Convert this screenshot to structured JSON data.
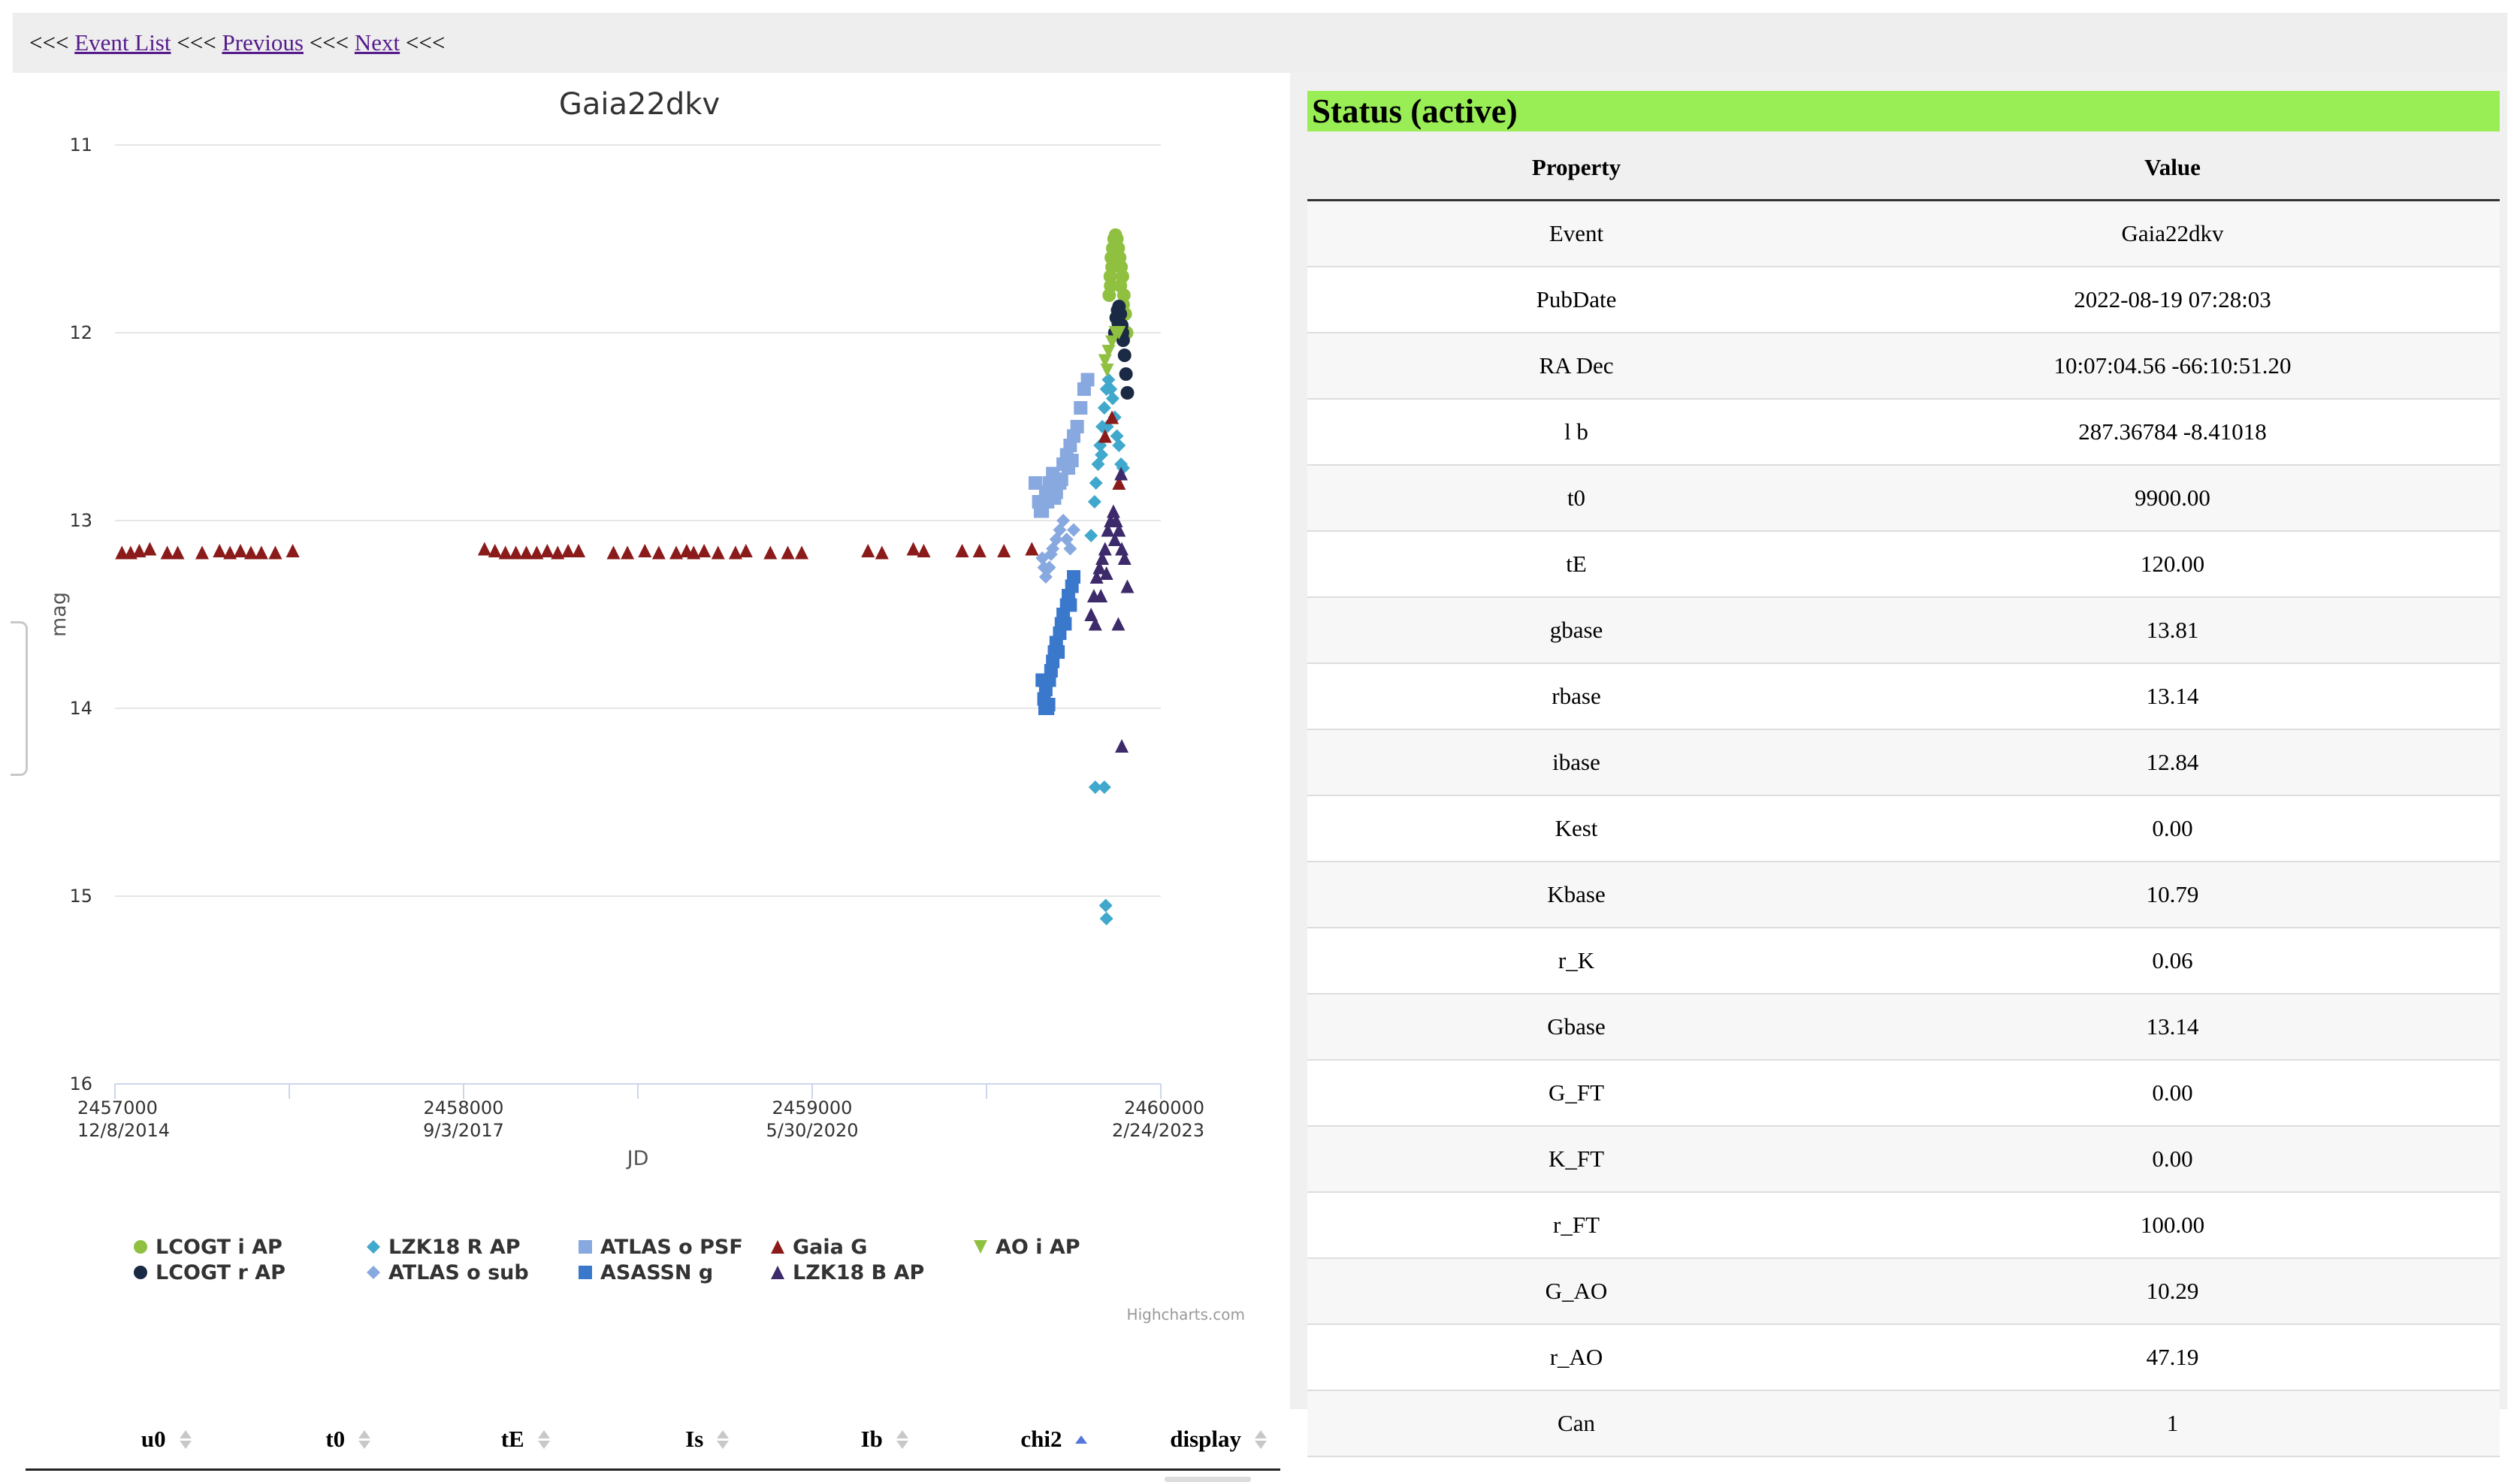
{
  "nav": {
    "sep": "<<<",
    "event_list": "Event List",
    "previous": "Previous",
    "next": "Next"
  },
  "chart_data": {
    "type": "scatter",
    "title": "Gaia22dkv",
    "xlabel": "JD",
    "ylabel": "mag",
    "xlim": [
      2457000,
      2460000
    ],
    "ylim": [
      16,
      11
    ],
    "y_reversed": true,
    "grid": true,
    "legend_position": "bottom",
    "x_ticks": [
      {
        "value": 2457000,
        "label": "2457000",
        "date": "12/8/2014"
      },
      {
        "value": 2458000,
        "label": "2458000",
        "date": "9/3/2017"
      },
      {
        "value": 2459000,
        "label": "2459000",
        "date": "5/30/2020"
      },
      {
        "value": 2460000,
        "label": "2460000",
        "date": "2/24/2023"
      }
    ],
    "y_ticks": [
      11,
      12,
      13,
      14,
      15,
      16
    ],
    "credits": "Highcharts.com",
    "series": [
      {
        "name": "LCOGT i AP",
        "color": "#90c040",
        "marker": "circle",
        "points": [
          [
            2459855,
            11.7
          ],
          [
            2459858,
            11.6
          ],
          [
            2459862,
            11.55
          ],
          [
            2459866,
            11.5
          ],
          [
            2459870,
            11.48
          ],
          [
            2459874,
            11.5
          ],
          [
            2459878,
            11.55
          ],
          [
            2459882,
            11.6
          ],
          [
            2459886,
            11.65
          ],
          [
            2459890,
            11.7
          ],
          [
            2459894,
            11.8
          ],
          [
            2459898,
            11.9
          ],
          [
            2459902,
            12.0
          ],
          [
            2459852,
            11.8
          ],
          [
            2459856,
            11.75
          ],
          [
            2459860,
            11.65
          ],
          [
            2459872,
            11.6
          ],
          [
            2459884,
            11.75
          ],
          [
            2459892,
            11.85
          ]
        ]
      },
      {
        "name": "LCOGT r AP",
        "color": "#1a2a44",
        "marker": "circle",
        "points": [
          [
            2459868,
            12.0
          ],
          [
            2459872,
            11.92
          ],
          [
            2459876,
            11.88
          ],
          [
            2459880,
            11.86
          ],
          [
            2459884,
            11.9
          ],
          [
            2459888,
            11.96
          ],
          [
            2459892,
            12.04
          ],
          [
            2459896,
            12.12
          ],
          [
            2459900,
            12.22
          ],
          [
            2459904,
            12.32
          ],
          [
            2459878,
            11.95
          ],
          [
            2459890,
            12.0
          ]
        ]
      },
      {
        "name": "LZK18 R AP",
        "color": "#40a8cc",
        "marker": "diamond",
        "points": [
          [
            2459820,
            12.7
          ],
          [
            2459826,
            12.6
          ],
          [
            2459832,
            12.5
          ],
          [
            2459838,
            12.4
          ],
          [
            2459844,
            12.3
          ],
          [
            2459850,
            12.25
          ],
          [
            2459856,
            12.3
          ],
          [
            2459862,
            12.35
          ],
          [
            2459868,
            12.45
          ],
          [
            2459874,
            12.55
          ],
          [
            2459880,
            12.6
          ],
          [
            2459886,
            12.7
          ],
          [
            2459892,
            12.72
          ],
          [
            2459810,
            12.9
          ],
          [
            2459814,
            12.8
          ],
          [
            2459830,
            12.65
          ],
          [
            2459846,
            12.5
          ],
          [
            2459800,
            13.08
          ],
          [
            2459812,
            14.42
          ],
          [
            2459838,
            14.42
          ],
          [
            2459842,
            15.05
          ],
          [
            2459844,
            15.12
          ]
        ]
      },
      {
        "name": "ATLAS o sub",
        "color": "#88a8e0",
        "marker": "diamond",
        "points": [
          [
            2459660,
            13.2
          ],
          [
            2459670,
            13.3
          ],
          [
            2459680,
            13.25
          ],
          [
            2459690,
            13.15
          ],
          [
            2459700,
            13.1
          ],
          [
            2459710,
            13.05
          ],
          [
            2459720,
            13.0
          ],
          [
            2459730,
            13.1
          ],
          [
            2459740,
            13.15
          ],
          [
            2459750,
            13.05
          ],
          [
            2459665,
            13.25
          ],
          [
            2459685,
            13.18
          ]
        ]
      },
      {
        "name": "ATLAS o PSF",
        "color": "#88a8e0",
        "marker": "square",
        "points": [
          [
            2459640,
            12.8
          ],
          [
            2459650,
            12.9
          ],
          [
            2459660,
            12.95
          ],
          [
            2459670,
            12.85
          ],
          [
            2459680,
            12.8
          ],
          [
            2459690,
            12.75
          ],
          [
            2459700,
            12.85
          ],
          [
            2459710,
            12.8
          ],
          [
            2459720,
            12.7
          ],
          [
            2459730,
            12.65
          ],
          [
            2459740,
            12.6
          ],
          [
            2459750,
            12.55
          ],
          [
            2459760,
            12.5
          ],
          [
            2459770,
            12.4
          ],
          [
            2459780,
            12.3
          ],
          [
            2459790,
            12.25
          ],
          [
            2459655,
            12.95
          ],
          [
            2459675,
            12.9
          ],
          [
            2459695,
            12.88
          ],
          [
            2459715,
            12.78
          ],
          [
            2459735,
            12.72
          ],
          [
            2459745,
            12.68
          ]
        ]
      },
      {
        "name": "ASASSN g",
        "color": "#3a78cc",
        "marker": "square",
        "points": [
          [
            2459660,
            13.85
          ],
          [
            2459665,
            13.95
          ],
          [
            2459670,
            13.9
          ],
          [
            2459675,
            14.0
          ],
          [
            2459680,
            13.85
          ],
          [
            2459685,
            13.8
          ],
          [
            2459690,
            13.75
          ],
          [
            2459695,
            13.7
          ],
          [
            2459700,
            13.65
          ],
          [
            2459705,
            13.7
          ],
          [
            2459710,
            13.6
          ],
          [
            2459715,
            13.55
          ],
          [
            2459720,
            13.5
          ],
          [
            2459725,
            13.55
          ],
          [
            2459730,
            13.45
          ],
          [
            2459735,
            13.4
          ],
          [
            2459740,
            13.45
          ],
          [
            2459745,
            13.35
          ],
          [
            2459750,
            13.3
          ],
          [
            2459668,
            14.0
          ],
          [
            2459678,
            13.98
          ]
        ]
      },
      {
        "name": "Gaia G",
        "color": "#8b1a1a",
        "marker": "triangle",
        "points": [
          [
            2457020,
            13.17
          ],
          [
            2457045,
            13.17
          ],
          [
            2457070,
            13.16
          ],
          [
            2457100,
            13.15
          ],
          [
            2457150,
            13.17
          ],
          [
            2457180,
            13.17
          ],
          [
            2457250,
            13.17
          ],
          [
            2457300,
            13.16
          ],
          [
            2457330,
            13.17
          ],
          [
            2457360,
            13.16
          ],
          [
            2457390,
            13.17
          ],
          [
            2457420,
            13.17
          ],
          [
            2457460,
            13.17
          ],
          [
            2457510,
            13.16
          ],
          [
            2458060,
            13.15
          ],
          [
            2458090,
            13.16
          ],
          [
            2458120,
            13.17
          ],
          [
            2458150,
            13.17
          ],
          [
            2458180,
            13.17
          ],
          [
            2458210,
            13.17
          ],
          [
            2458240,
            13.16
          ],
          [
            2458270,
            13.17
          ],
          [
            2458300,
            13.16
          ],
          [
            2458330,
            13.16
          ],
          [
            2458430,
            13.17
          ],
          [
            2458470,
            13.17
          ],
          [
            2458520,
            13.16
          ],
          [
            2458560,
            13.17
          ],
          [
            2458610,
            13.17
          ],
          [
            2458640,
            13.16
          ],
          [
            2458660,
            13.17
          ],
          [
            2458690,
            13.16
          ],
          [
            2458730,
            13.17
          ],
          [
            2458780,
            13.17
          ],
          [
            2458810,
            13.16
          ],
          [
            2458880,
            13.17
          ],
          [
            2458930,
            13.17
          ],
          [
            2458970,
            13.17
          ],
          [
            2459160,
            13.16
          ],
          [
            2459200,
            13.17
          ],
          [
            2459290,
            13.15
          ],
          [
            2459320,
            13.16
          ],
          [
            2459430,
            13.16
          ],
          [
            2459480,
            13.16
          ],
          [
            2459550,
            13.16
          ],
          [
            2459630,
            13.15
          ],
          [
            2459840,
            12.55
          ],
          [
            2459860,
            12.45
          ],
          [
            2459880,
            12.8
          ]
        ]
      },
      {
        "name": "AO i AP",
        "color": "#90c040",
        "marker": "triangle-down",
        "points": [
          [
            2459840,
            12.15
          ],
          [
            2459850,
            12.1
          ],
          [
            2459860,
            12.05
          ],
          [
            2459870,
            12.0
          ],
          [
            2459880,
            12.0
          ],
          [
            2459846,
            12.2
          ]
        ]
      },
      {
        "name": "LZK18 B AP",
        "color": "#3c2a6a",
        "marker": "triangle",
        "points": [
          [
            2459800,
            13.5
          ],
          [
            2459808,
            13.4
          ],
          [
            2459816,
            13.3
          ],
          [
            2459824,
            13.25
          ],
          [
            2459832,
            13.2
          ],
          [
            2459840,
            13.15
          ],
          [
            2459848,
            13.05
          ],
          [
            2459856,
            13.0
          ],
          [
            2459864,
            12.95
          ],
          [
            2459872,
            13.0
          ],
          [
            2459880,
            13.05
          ],
          [
            2459888,
            13.15
          ],
          [
            2459896,
            13.2
          ],
          [
            2459904,
            13.35
          ],
          [
            2459812,
            13.55
          ],
          [
            2459828,
            13.4
          ],
          [
            2459844,
            13.28
          ],
          [
            2459868,
            13.1
          ],
          [
            2459886,
            12.75
          ],
          [
            2459878,
            13.55
          ],
          [
            2459888,
            14.2
          ]
        ]
      }
    ]
  },
  "fit_table": {
    "columns": [
      {
        "label": "u0",
        "sort": "none"
      },
      {
        "label": "t0",
        "sort": "none"
      },
      {
        "label": "tE",
        "sort": "none"
      },
      {
        "label": "Is",
        "sort": "none"
      },
      {
        "label": "Ib",
        "sort": "none"
      },
      {
        "label": "chi2",
        "sort": "asc"
      },
      {
        "label": "display",
        "sort": "none"
      }
    ]
  },
  "status": {
    "title": "Status (active)",
    "header_color": "#99ee55",
    "headers": {
      "property": "Property",
      "value": "Value"
    },
    "rows": [
      {
        "property": "Event",
        "value": "Gaia22dkv"
      },
      {
        "property": "PubDate",
        "value": "2022-08-19 07:28:03"
      },
      {
        "property": "RA  Dec",
        "value": "10:07:04.56  -66:10:51.20"
      },
      {
        "property": "l  b",
        "value": "287.36784  -8.41018"
      },
      {
        "property": "t0",
        "value": "9900.00"
      },
      {
        "property": "tE",
        "value": "120.00"
      },
      {
        "property": "gbase",
        "value": "13.81"
      },
      {
        "property": "rbase",
        "value": "13.14"
      },
      {
        "property": "ibase",
        "value": "12.84"
      },
      {
        "property": "Kest",
        "value": "0.00"
      },
      {
        "property": "Kbase",
        "value": "10.79"
      },
      {
        "property": "r_K",
        "value": "0.06"
      },
      {
        "property": "Gbase",
        "value": "13.14"
      },
      {
        "property": "G_FT",
        "value": "0.00"
      },
      {
        "property": "K_FT",
        "value": "0.00"
      },
      {
        "property": "r_FT",
        "value": "100.00"
      },
      {
        "property": "G_AO",
        "value": "10.29"
      },
      {
        "property": "r_AO",
        "value": "47.19"
      },
      {
        "property": "Can",
        "value": "1"
      }
    ]
  }
}
